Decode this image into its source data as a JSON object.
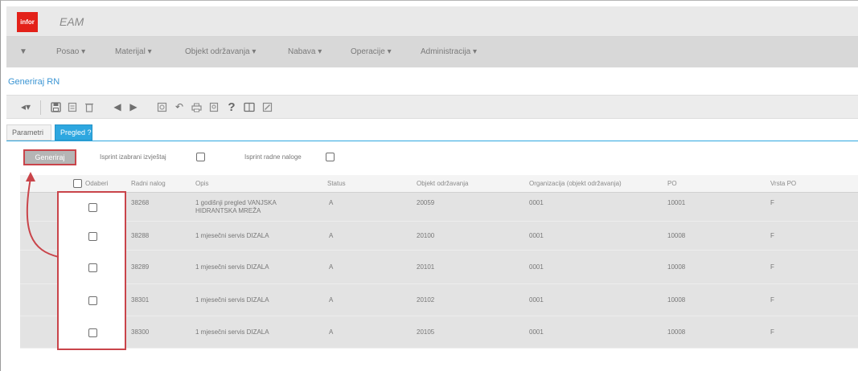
{
  "header": {
    "logo_text": "infor",
    "app_title": "EAM"
  },
  "menu": {
    "items": [
      "Posao ▾",
      "Materijal ▾",
      "Objekt održavanja ▾",
      "Nabava ▾",
      "Operacije ▾",
      "Administracija ▾"
    ]
  },
  "page": {
    "title": "Generiraj RN"
  },
  "tabs": {
    "params": "Parametri",
    "preview": "Pregled ?"
  },
  "actions": {
    "generate_label": "Generiraj",
    "option1_label": "Isprint izabrani izvještaj",
    "option2_label": "Isprint radne naloge"
  },
  "grid": {
    "columns": [
      "Odaberi",
      "Radni nalog",
      "Opis",
      "Status",
      "Objekt održavanja",
      "Organizacija (objekt održavanja)",
      "PO",
      "Vrsta PO"
    ],
    "rows": [
      {
        "wo": "38268",
        "desc_line1": "1 godišnji pregled VANJSKA",
        "desc_line2": "HIDRANTSKA MREŽA",
        "status": "A",
        "object": "20059",
        "org": "0001",
        "po": "10001",
        "type": "F"
      },
      {
        "wo": "38288",
        "desc_line1": "1 mjesečni servis DIZALA",
        "desc_line2": "",
        "status": "A",
        "object": "20100",
        "org": "0001",
        "po": "10008",
        "type": "F"
      },
      {
        "wo": "38289",
        "desc_line1": "1 mjesečni servis DIZALA",
        "desc_line2": "",
        "status": "A",
        "object": "20101",
        "org": "0001",
        "po": "10008",
        "type": "F"
      },
      {
        "wo": "38301",
        "desc_line1": "1 mjesečni servis DIZALA",
        "desc_line2": "",
        "status": "A",
        "object": "20102",
        "org": "0001",
        "po": "10008",
        "type": "F"
      },
      {
        "wo": "38300",
        "desc_line1": "1 mjesečni servis DIZALA",
        "desc_line2": "",
        "status": "A",
        "object": "20105",
        "org": "0001",
        "po": "10008",
        "type": "F"
      }
    ]
  },
  "colors": {
    "accent": "#2ea7e0",
    "logo": "#e32119",
    "annotation": "#c9444a"
  },
  "icons": [
    "nav-back-icon",
    "save-icon",
    "copy-icon",
    "delete-icon",
    "prev-record-icon",
    "next-record-icon",
    "attach-icon",
    "undo-icon",
    "print-icon",
    "query-icon",
    "help-icon",
    "book-icon",
    "edit-icon"
  ]
}
